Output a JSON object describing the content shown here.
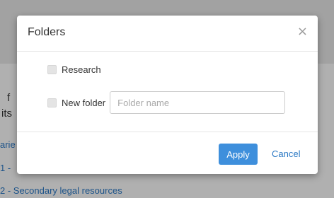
{
  "background": {
    "text_fragment_1": "f",
    "text_fragment_2": "its",
    "link_fragment_1": "arie",
    "link_fragment_2": "1 -",
    "link_fragment_3": "2 - Secondary legal resources"
  },
  "modal": {
    "title": "Folders",
    "close_symbol": "×",
    "options": [
      {
        "label": "Research",
        "checked": false
      },
      {
        "label": "New folder",
        "checked": false
      }
    ],
    "folder_input": {
      "placeholder": "Folder name",
      "value": ""
    },
    "apply_label": "Apply",
    "cancel_label": "Cancel"
  },
  "colors": {
    "primary_button": "#3e8fdc",
    "link": "#2a78c4"
  }
}
